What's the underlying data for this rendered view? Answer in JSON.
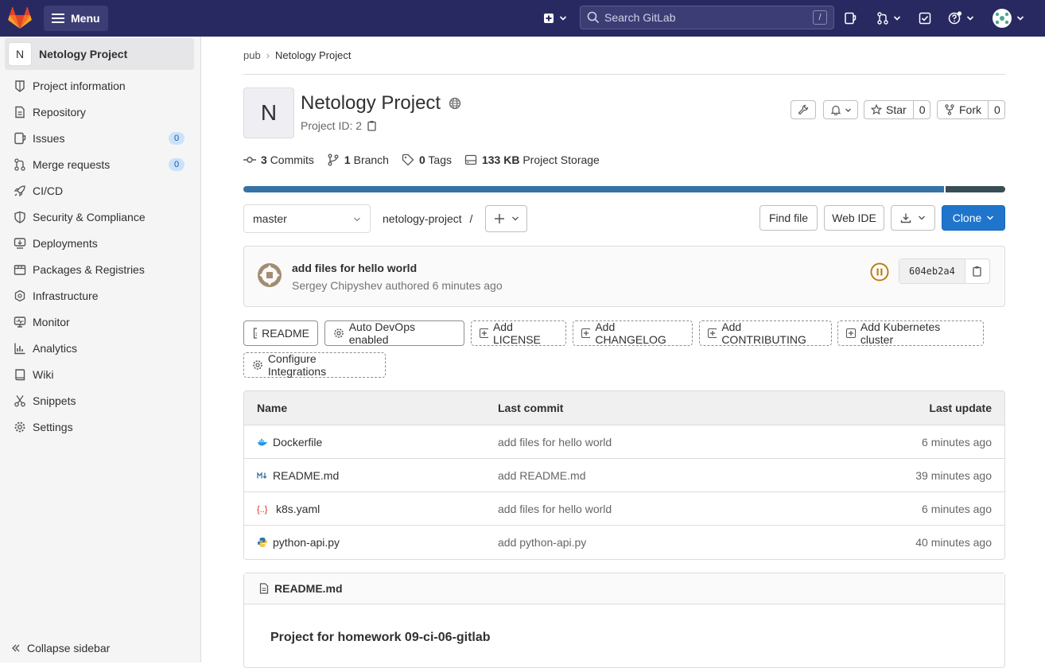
{
  "topbar": {
    "menu_label": "Menu",
    "search_placeholder": "Search GitLab",
    "search_shortcut": "/"
  },
  "sidebar": {
    "project_initial": "N",
    "project_name": "Netology Project",
    "items": [
      {
        "label": "Project information",
        "icon": "info-icon"
      },
      {
        "label": "Repository",
        "icon": "doc-icon"
      },
      {
        "label": "Issues",
        "icon": "issues-icon",
        "badge": "0"
      },
      {
        "label": "Merge requests",
        "icon": "merge-request-icon",
        "badge": "0"
      },
      {
        "label": "CI/CD",
        "icon": "rocket-icon"
      },
      {
        "label": "Security & Compliance",
        "icon": "shield-icon"
      },
      {
        "label": "Deployments",
        "icon": "deployments-icon"
      },
      {
        "label": "Packages & Registries",
        "icon": "package-icon"
      },
      {
        "label": "Infrastructure",
        "icon": "cloud-icon"
      },
      {
        "label": "Monitor",
        "icon": "monitor-icon"
      },
      {
        "label": "Analytics",
        "icon": "chart-icon"
      },
      {
        "label": "Wiki",
        "icon": "book-icon"
      },
      {
        "label": "Snippets",
        "icon": "snippet-icon"
      },
      {
        "label": "Settings",
        "icon": "gear-icon"
      }
    ],
    "collapse_label": "Collapse sidebar"
  },
  "breadcrumb": {
    "parent": "pub",
    "current": "Netology Project"
  },
  "project": {
    "initial": "N",
    "title": "Netology Project",
    "id_text": "Project ID: 2",
    "star_label": "Star",
    "star_count": "0",
    "fork_label": "Fork",
    "fork_count": "0"
  },
  "stats": {
    "commits_count": "3",
    "commits_label": "Commits",
    "branches_count": "1",
    "branches_label": "Branch",
    "tags_count": "0",
    "tags_label": "Tags",
    "storage_size": "133 KB",
    "storage_label": "Project Storage"
  },
  "language_bar": [
    {
      "fraction": 0.92,
      "color": "#3572a5"
    },
    {
      "fraction": 0.08,
      "color": "#384d54"
    }
  ],
  "repo": {
    "branch": "master",
    "path": "netology-project",
    "path_sep": "/",
    "find_file": "Find file",
    "web_ide": "Web IDE",
    "clone": "Clone"
  },
  "last_commit": {
    "message": "add files for hello world",
    "author": "Sergey Chipyshev",
    "authored_text": "authored 6 minutes ago",
    "sha": "604eb2a4"
  },
  "quick_actions": {
    "readme": "README",
    "auto_devops": "Auto DevOps enabled",
    "add_license": "Add LICENSE",
    "add_changelog": "Add CHANGELOG",
    "add_contributing": "Add CONTRIBUTING",
    "add_k8s": "Add Kubernetes cluster",
    "configure": "Configure Integrations"
  },
  "files": {
    "headers": {
      "name": "Name",
      "last_commit": "Last commit",
      "last_update": "Last update"
    },
    "rows": [
      {
        "name": "Dockerfile",
        "icon": "docker-icon",
        "commit": "add files for hello world",
        "updated": "6 minutes ago"
      },
      {
        "name": "README.md",
        "icon": "markdown-icon",
        "commit": "add README.md",
        "updated": "39 minutes ago"
      },
      {
        "name": "k8s.yaml",
        "icon": "yaml-icon",
        "commit": "add files for hello world",
        "updated": "6 minutes ago"
      },
      {
        "name": "python-api.py",
        "icon": "python-icon",
        "commit": "add python-api.py",
        "updated": "40 minutes ago"
      }
    ]
  },
  "readme": {
    "filename": "README.md",
    "heading": "Project for homework 09-ci-06-gitlab"
  },
  "colors": {
    "topbar": "#292961",
    "primary": "#1f75cb",
    "pipeline": "#c17d10"
  }
}
